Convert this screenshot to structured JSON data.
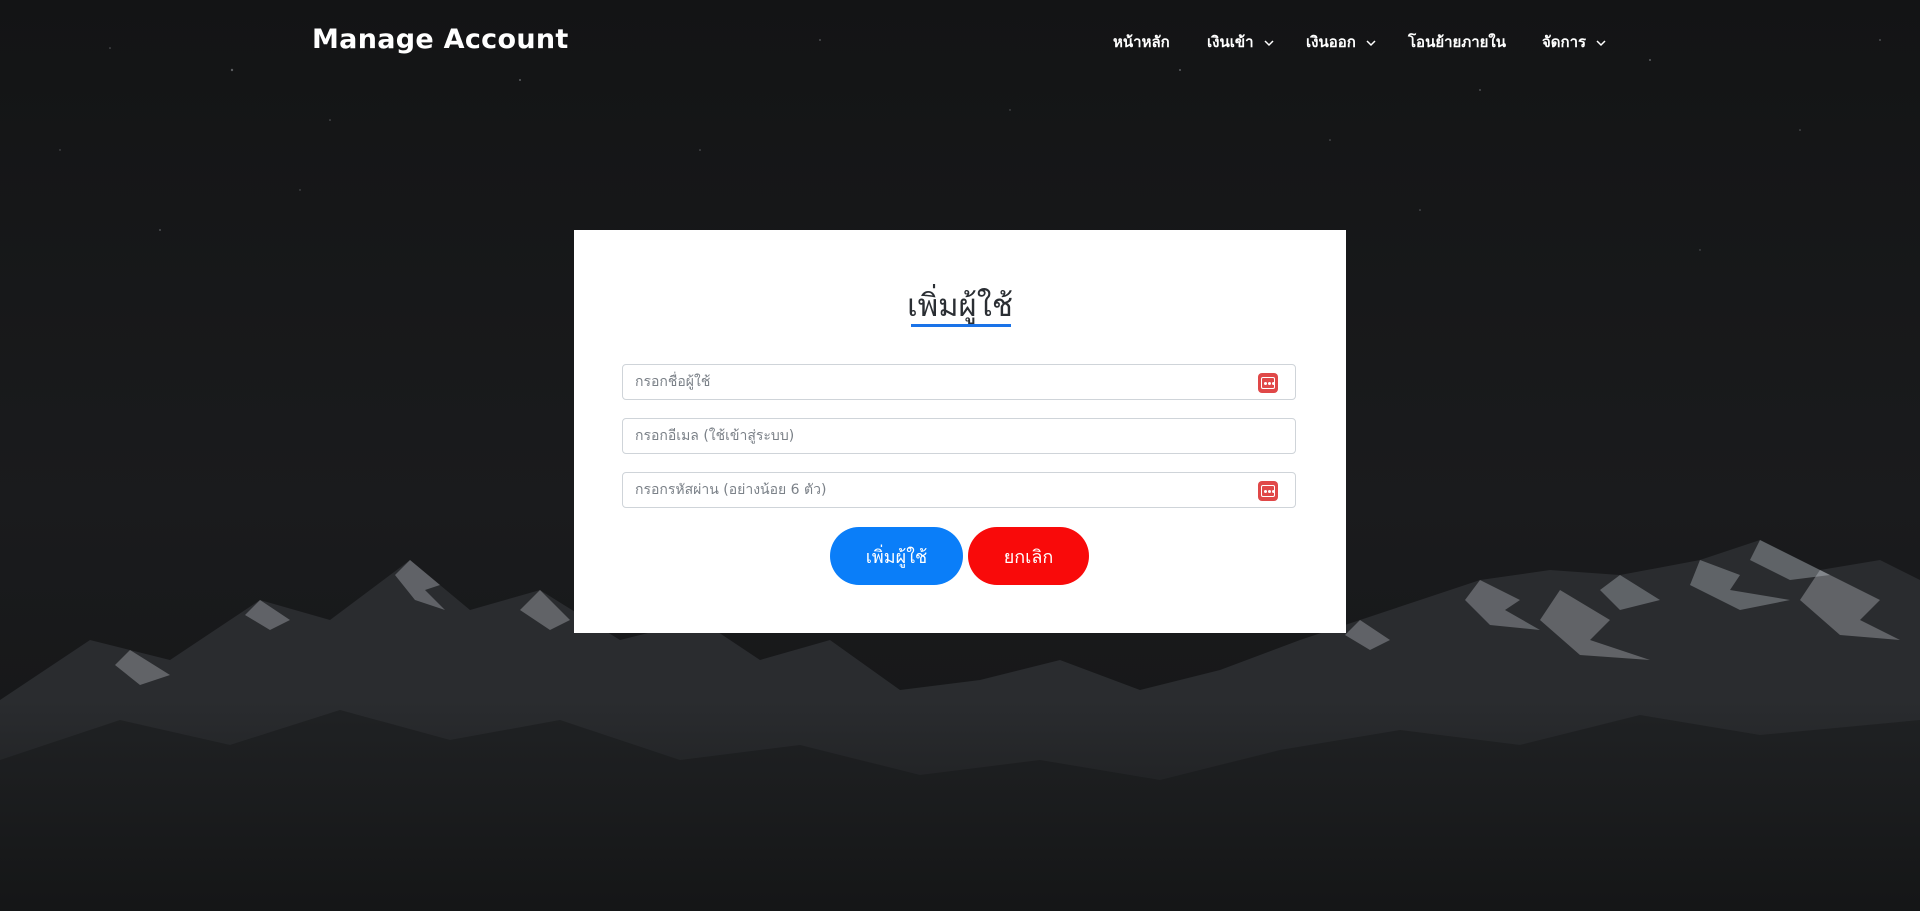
{
  "header": {
    "brand": "Manage Account",
    "nav": [
      {
        "label": "หน้าหลัก",
        "dropdown": false
      },
      {
        "label": "เงินเข้า",
        "dropdown": true
      },
      {
        "label": "เงินออก",
        "dropdown": true
      },
      {
        "label": "โอนย้ายภายใน",
        "dropdown": false
      },
      {
        "label": "จัดการ",
        "dropdown": true
      }
    ]
  },
  "form": {
    "title": "เพิ่มผู้ใช้",
    "username_placeholder": "กรอกชื่อผู้ใช้",
    "email_placeholder": "กรอกอีเมล (ใช้เข้าสู่ระบบ)",
    "password_placeholder": "กรอกรหัสผ่าน (อย่างน้อย 6 ตัว)",
    "submit_label": "เพิ่มผู้ใช้",
    "cancel_label": "ยกเลิก"
  },
  "colors": {
    "accent": "#0a7ef9",
    "danger": "#f90a0a",
    "underline": "#1a73e8",
    "password_manager_icon": "#e04848"
  },
  "icons": {
    "nav_dropdown": "chevron-down-icon",
    "password_manager": "password-manager-icon"
  }
}
